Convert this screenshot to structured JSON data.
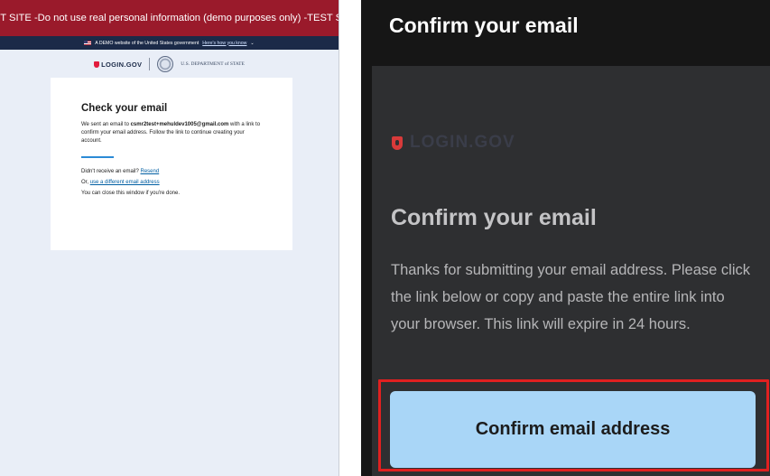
{
  "left": {
    "test_banner": "TEST SITE -Do not use real personal information (demo purposes only) -TEST SITE",
    "gov_banner": {
      "text": "A DEMO website of the United States government",
      "link": "Here's how you know",
      "flag_icon": "us-flag-icon",
      "chevron_icon": "chevron-down-icon"
    },
    "logos": {
      "login_gov": "LOGIN.GOV",
      "dos": "U.S. DEPARTMENT of STATE",
      "seal_icon": "state-department-seal"
    },
    "card": {
      "title": "Check your email",
      "body_prefix": "We sent an email to ",
      "email": "csmr2test+mehuldev1005@gmail.com",
      "body_suffix": " with a link to confirm your email address. Follow the link to continue creating your account.",
      "resend_prompt": "Didn't receive an email?",
      "resend_link": "Resend",
      "different_prefix": "Or,",
      "different_link": "use a different email address",
      "close_note": "You can close this window if you're done."
    },
    "colors": {
      "banner": "#9a1a2b",
      "gov_banner": "#1b2a48",
      "link": "#005ea2",
      "accent_bar": "#2b8bd6"
    }
  },
  "right": {
    "header_title": "Confirm your email",
    "logo_text": "LOGIN.GOV",
    "logo_icon": "login-gov-shield-icon",
    "heading": "Confirm your email",
    "paragraph": "Thanks for submitting your email address. Please click the link below or copy and paste the entire link into your browser. This link will expire in 24 hours.",
    "button_label": "Confirm email address",
    "colors": {
      "background": "#161616",
      "card": "#2e2f31",
      "button": "#a9d6f7",
      "highlight": "#e02020"
    }
  }
}
